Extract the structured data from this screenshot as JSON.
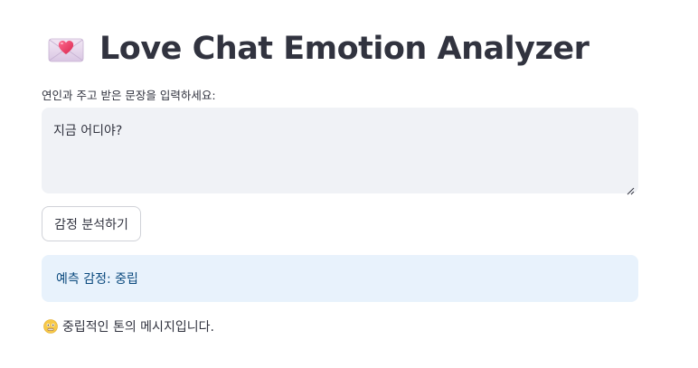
{
  "header": {
    "icon": "love-letter-icon",
    "title": "Love Chat Emotion Analyzer"
  },
  "input": {
    "label": "연인과 주고 받은 문장을 입력하세요:",
    "value": "지금 어디야?"
  },
  "actions": {
    "analyze_label": "감정 분석하기"
  },
  "result": {
    "prediction_text": "예측 감정: 중립",
    "tone_icon": "neutral-face-icon",
    "tone_text": "중립적인 톤의 메시지입니다."
  },
  "colors": {
    "text": "#31333f",
    "textarea_bg": "#f0f2f6",
    "info_bg": "#e8f2fc",
    "info_text": "#0b4a7e",
    "heart": "#e8456b"
  }
}
